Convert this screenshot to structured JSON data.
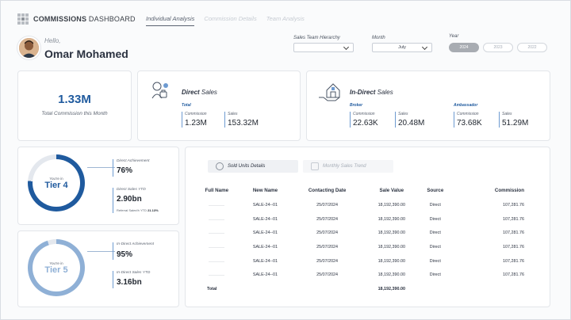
{
  "app": {
    "title_bold": "COMMISSIONS",
    "title_rest": " DASHBOARD"
  },
  "tabs": [
    {
      "label": "Individual Analysis",
      "active": true
    },
    {
      "label": "Commission Details",
      "active": false
    },
    {
      "label": "Team Analysis",
      "active": false
    }
  ],
  "user": {
    "greeting": "Hello,",
    "name": "Omar Mohamed"
  },
  "filters": {
    "team_label": "Sales Team Hierarchy",
    "team_value": "",
    "month_label": "Month",
    "month_value": "July",
    "year_label": "Year",
    "years": [
      {
        "label": "2024",
        "active": true
      },
      {
        "label": "2023",
        "active": false
      },
      {
        "label": "2022",
        "active": false
      }
    ]
  },
  "total_commission": {
    "value": "1.33M",
    "label": "Total Commission this Month"
  },
  "direct_sales": {
    "title_bold": "Direct",
    "title_rest": " Sales",
    "sub": "Total",
    "metrics": [
      {
        "label": "Commission",
        "value": "1.23M"
      },
      {
        "label": "Sales",
        "value": "153.32M"
      }
    ]
  },
  "indirect_sales": {
    "title_bold": "In-Direct",
    "title_rest": " Sales",
    "broker": {
      "sub": "Broker",
      "metrics": [
        {
          "label": "Commission",
          "value": "22.63K"
        },
        {
          "label": "Sales",
          "value": "20.48M"
        }
      ]
    },
    "ambassador": {
      "sub": "Ambassador",
      "metrics": [
        {
          "label": "Commission",
          "value": "73.68K"
        },
        {
          "label": "Sales",
          "value": "51.29M"
        }
      ]
    }
  },
  "tier_direct": {
    "youre_in": "You're in",
    "tier": "Tier 4",
    "achievement_label": "Direct Achievement",
    "achievement_value": "76%",
    "achievement_fraction": 0.76,
    "ytd_label": "Direct Sales YTD",
    "ytd_value": "2.90bn",
    "referral_label": "Referral Sales% YTD",
    "referral_value": "21.13%",
    "color": "#1f5a9e"
  },
  "tier_indirect": {
    "youre_in": "You're in",
    "tier": "Tier 5",
    "achievement_label": "In-Direct Achievement",
    "achievement_value": "95%",
    "achievement_fraction": 0.95,
    "ytd_label": "In-Direct Sales YTD",
    "ytd_value": "3.16bn",
    "color": "#8fb0d6"
  },
  "table_tabs": [
    {
      "label": "Sold Units Details",
      "active": true,
      "icon": "target-icon"
    },
    {
      "label": "Monthly Sales Trend",
      "active": false,
      "icon": "checkbox-icon"
    }
  ],
  "table": {
    "columns": [
      "Full Name",
      "New Name",
      "Contacting Date",
      "Sale Value",
      "Source",
      "Commission"
    ],
    "rows": [
      [
        "..........",
        "SALE-24--01",
        "25/07/2024",
        "18,192,390.00",
        "Direct",
        "107,281.76"
      ],
      [
        "..........",
        "SALE-24--01",
        "25/07/2024",
        "18,192,390.00",
        "Direct",
        "107,281.76"
      ],
      [
        "..........",
        "SALE-24--01",
        "25/07/2024",
        "18,192,390.00",
        "Direct",
        "107,281.76"
      ],
      [
        "..........",
        "SALE-24--01",
        "25/07/2024",
        "18,192,390.00",
        "Direct",
        "107,281.76"
      ],
      [
        "..........",
        "SALE-24--01",
        "25/07/2024",
        "18,192,390.00",
        "Direct",
        "107,281.76"
      ],
      [
        "..........",
        "SALE-24--01",
        "25/07/2024",
        "18,192,390.00",
        "Direct",
        "107,281.76"
      ]
    ],
    "total": [
      "Total",
      "",
      "",
      "18,192,390.00",
      "",
      ""
    ]
  }
}
